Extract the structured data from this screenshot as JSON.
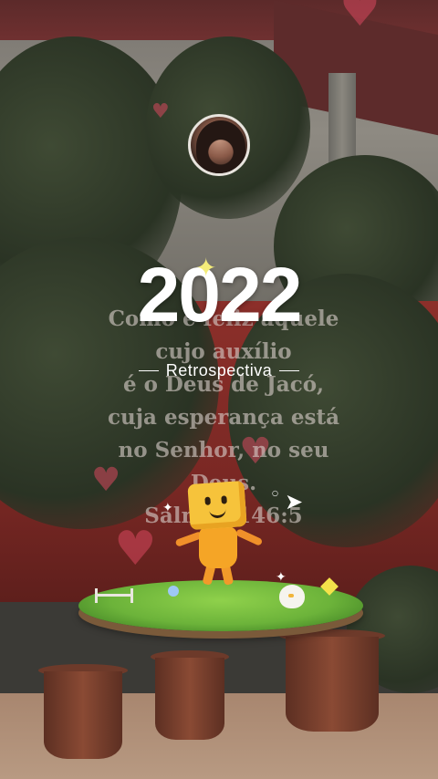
{
  "profile": {
    "avatar_icon": "user-avatar-photo"
  },
  "background": {
    "verse_lines": [
      "Como é feliz aquele",
      "cujo auxílio",
      "é o Deus de Jacó,",
      "cuja esperança está",
      "no Senhor, no seu",
      "Deus.",
      "Salmos 146:5"
    ]
  },
  "story": {
    "year": "2022",
    "subtitle": "Retrospectiva",
    "sparkle_icon": "sparkle-icon",
    "mascot_icon": "mascot-illustration",
    "plane_icon": "paper-plane-icon"
  },
  "colors": {
    "year_text": "#ffffff",
    "sparkle": "#f4ec7a",
    "mascot": "#f6c33b",
    "grass": "#6cb33a",
    "wall": "#8c2f2a"
  }
}
